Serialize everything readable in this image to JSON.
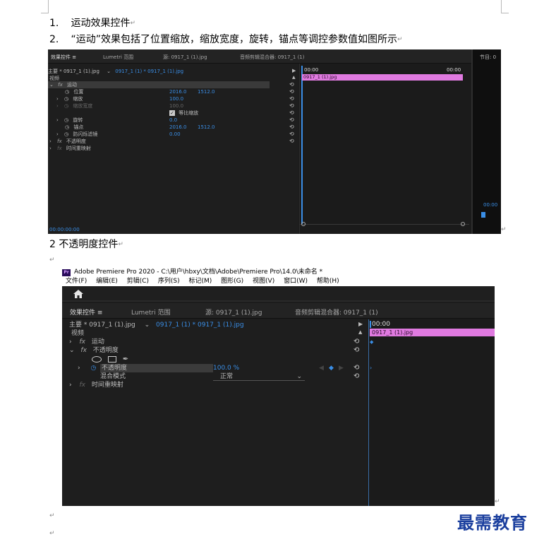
{
  "document": {
    "line1": {
      "num": "1.",
      "text": "运动效果控件"
    },
    "line2": {
      "num": "2.",
      "text": "“运动”效果包括了位置缩放，缩放宽度，旋转，锚点等调控参数值如图所示"
    },
    "heading2": "2 不透明度控件",
    "para_mark": "↵"
  },
  "screenshot1": {
    "tabs": [
      "效果控件 ≡",
      "Lumetri 范围",
      "源: 0917_1 (1).jpg",
      "音频剪辑混合器: 0917_1 (1)",
      "节目: 0"
    ],
    "source_label": "主要 * 0917_1 (1).jpg",
    "sequence_label": "0917_1 (1) * 0917_1 (1).jpg",
    "section_video": "视频",
    "effect_motion": "运动",
    "properties": [
      {
        "name": "位置",
        "value1": "2016.0",
        "value2": "1512.0"
      },
      {
        "name": "缩放",
        "value1": "100.0",
        "value2": ""
      },
      {
        "name": "缩放宽度",
        "value1": "100.0",
        "value2": ""
      },
      {
        "name": "等比缩放",
        "value1": "",
        "value2": ""
      },
      {
        "name": "旋转",
        "value1": "0.0",
        "value2": ""
      },
      {
        "name": "锚点",
        "value1": "2016.0",
        "value2": "1512.0"
      },
      {
        "name": "防闪烁滤镜",
        "value1": "0.00",
        "value2": ""
      }
    ],
    "effect_opacity": "不透明度",
    "effect_timeremap": "时间重映射",
    "time_start": "00:00",
    "time_end": "00:00",
    "clip_name": "0917_1 (1).jpg",
    "timecode": "00:00:00:00",
    "right_timecode": "00:00"
  },
  "screenshot2": {
    "title": "Adobe Premiere Pro 2020 - C:\\用户\\hbxy\\文档\\Adobe\\Premiere Pro\\14.0\\未命名 *",
    "logo": "Pr",
    "menu": [
      "文件(F)",
      "编辑(E)",
      "剪辑(C)",
      "序列(S)",
      "标记(M)",
      "图形(G)",
      "视图(V)",
      "窗口(W)",
      "帮助(H)"
    ],
    "tabs": [
      "效果控件 ≡",
      "Lumetri 范围",
      "源: 0917_1 (1).jpg",
      "音频剪辑混合器: 0917_1 (1)"
    ],
    "source_label": "主要 * 0917_1 (1).jpg",
    "sequence_label": "0917_1 (1) * 0917_1 (1).jpg",
    "section_video": "视频",
    "effect_motion": "运动",
    "effect_opacity": "不透明度",
    "opacity_label": "不透明度",
    "opacity_value": "100.0 %",
    "blend_label": "混合模式",
    "blend_value": "正常",
    "effect_timeremap": "时间重映射",
    "time_start": "00:00",
    "clip_name": "0917_1 (1).jpg"
  },
  "brand": "最需教育"
}
